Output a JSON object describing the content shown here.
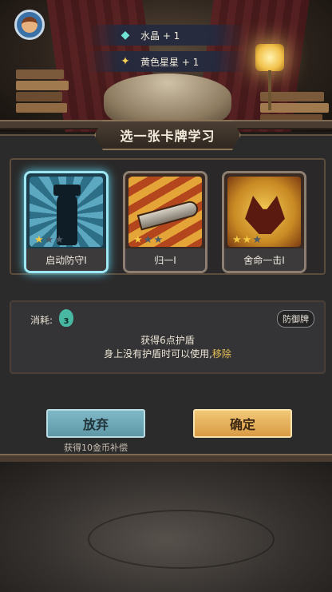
{
  "rewards": [
    {
      "icon": "crystal-icon",
      "text": "水晶 + 1"
    },
    {
      "icon": "star-icon",
      "text": "黄色星星 + 1"
    }
  ],
  "title": "选一张卡牌学习",
  "cards": [
    {
      "name": "启动防守I",
      "stars_filled": 1,
      "stars_total": 3,
      "selected": true
    },
    {
      "name": "归一I",
      "stars_filled": 1,
      "stars_total": 3,
      "selected": false
    },
    {
      "name": "舍命一击I",
      "stars_filled": 2,
      "stars_total": 3,
      "selected": false
    }
  ],
  "info": {
    "cost_label": "消耗:",
    "cost_value": "3",
    "type_tag": "防御牌",
    "desc_line1": "获得6点护盾",
    "desc_line2_pre": "身上没有护盾时可以使用,",
    "desc_line2_highlight": "移除"
  },
  "buttons": {
    "giveup": "放弃",
    "confirm": "确定",
    "compensation": "获得10金币补偿"
  },
  "colors": {
    "selected_glow": "#5ad0ea",
    "highlight": "#e8c05a",
    "giveup": "#6fa8b6",
    "confirm": "#e5b25e"
  }
}
